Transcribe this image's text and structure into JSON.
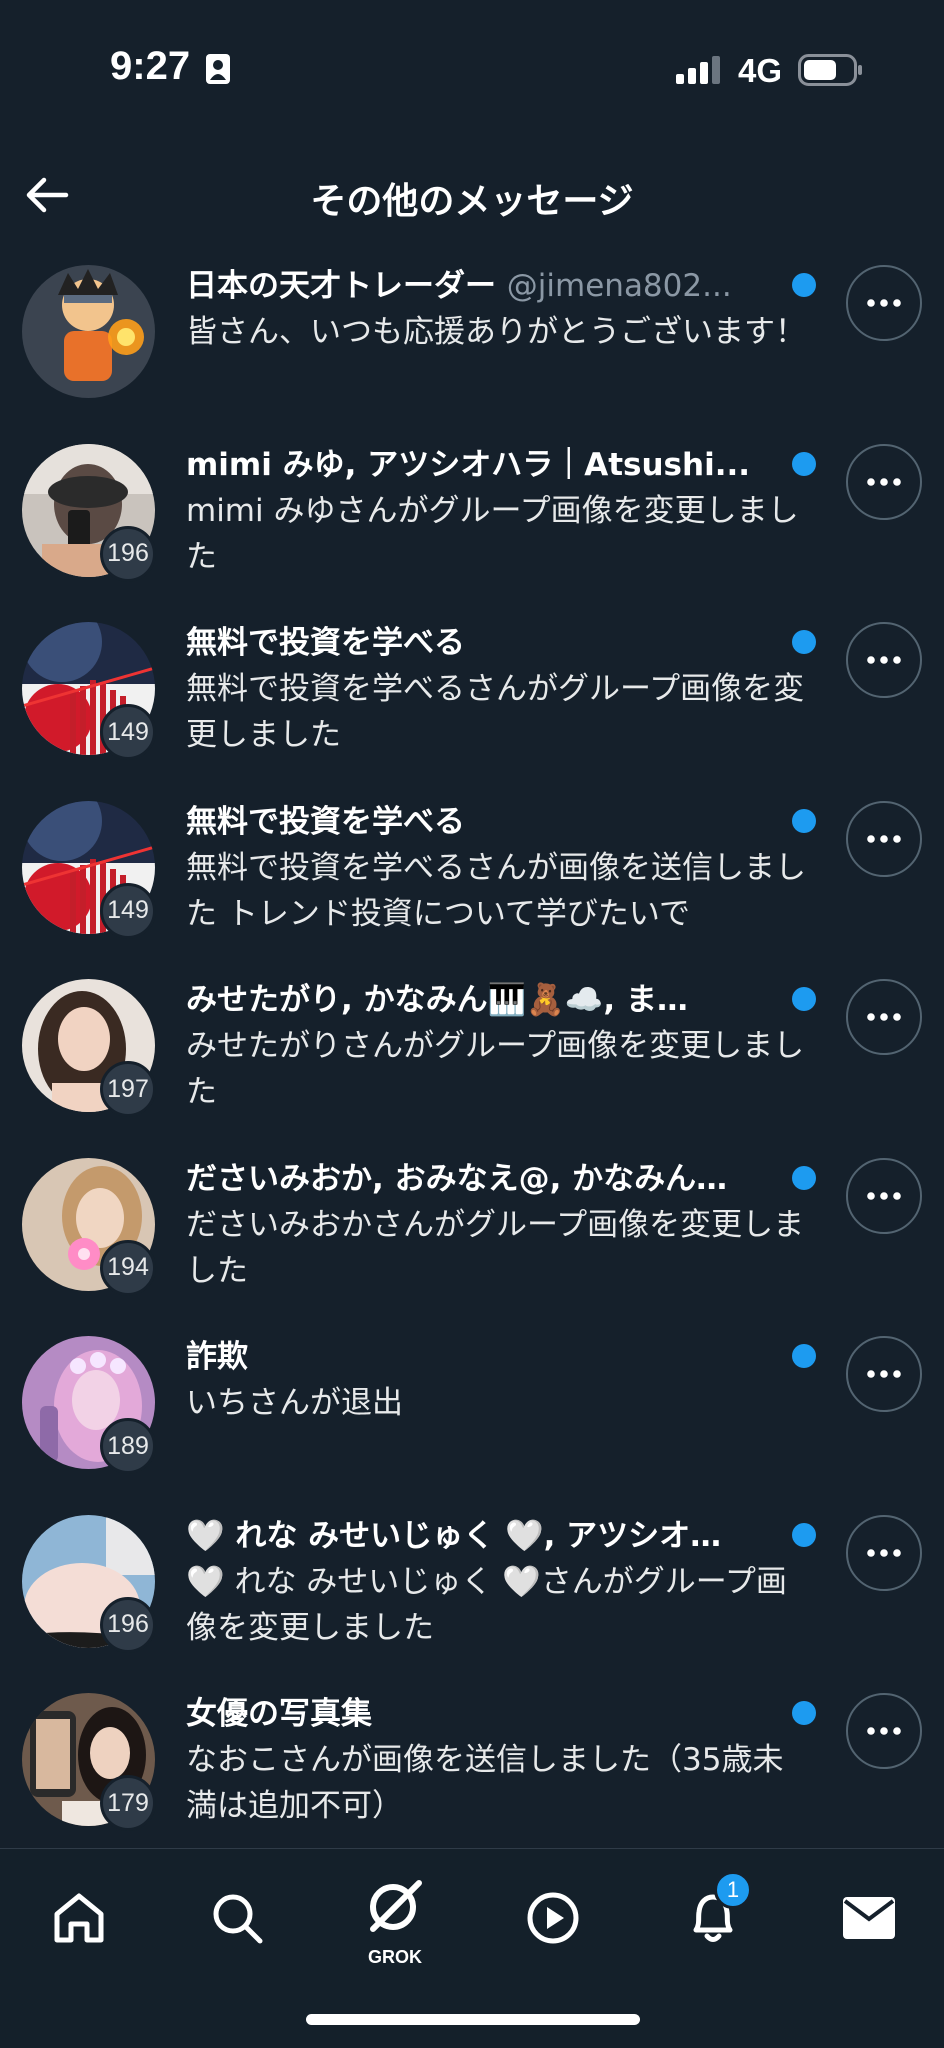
{
  "status_bar": {
    "time": "9:27",
    "network": "4G"
  },
  "header": {
    "title": "その他のメッセージ"
  },
  "conversations": [
    {
      "title": "日本の天才トレーダー",
      "handle": "@jimena802...",
      "snippet": "皆さん、いつも応援ありがとうございます！",
      "badge": "",
      "unread": true
    },
    {
      "title": "mimi みゆ, アツシオハラ｜Atsushi...",
      "handle": "",
      "snippet": "mimi みゆさんがグループ画像を変更しました",
      "badge": "196",
      "unread": true
    },
    {
      "title": "無料で投資を学べる",
      "handle": "",
      "snippet": "無料で投資を学べるさんがグループ画像を変更しました",
      "badge": "149",
      "unread": true
    },
    {
      "title": "無料で投資を学べる",
      "handle": "",
      "snippet": "無料で投資を学べるさんが画像を送信しました トレンド投資について学びたいで",
      "badge": "149",
      "unread": true
    },
    {
      "title": "みせたがり, かなみん🎹🧸☁️, ま…",
      "handle": "",
      "snippet": "みせたがりさんがグループ画像を変更しました",
      "badge": "197",
      "unread": true
    },
    {
      "title": "ださいみおか, おみなえ@, かなみん…",
      "handle": "",
      "snippet": "ださいみおかさんがグループ画像を変更しました",
      "badge": "194",
      "unread": true
    },
    {
      "title": "詐欺",
      "handle": "",
      "snippet": "いちさんが退出",
      "badge": "189",
      "unread": true
    },
    {
      "title": "🤍 れな みせいじゅく 🤍, アツシオ…",
      "handle": "",
      "snippet": "🤍 れな みせいじゅく 🤍さんがグループ画像を変更しました",
      "badge": "196",
      "unread": true
    },
    {
      "title": "女優の写真集",
      "handle": "",
      "snippet": "なおこさんが画像を送信しました（35歳未満は追加不可）",
      "badge": "179",
      "unread": true
    }
  ],
  "tab_bar": {
    "grok_label": "GROK",
    "notification_count": "1"
  },
  "colors": {
    "background": "#15202b",
    "accent": "#1d9bf0",
    "text": "#e7e9ea",
    "muted": "#8b98a5"
  }
}
